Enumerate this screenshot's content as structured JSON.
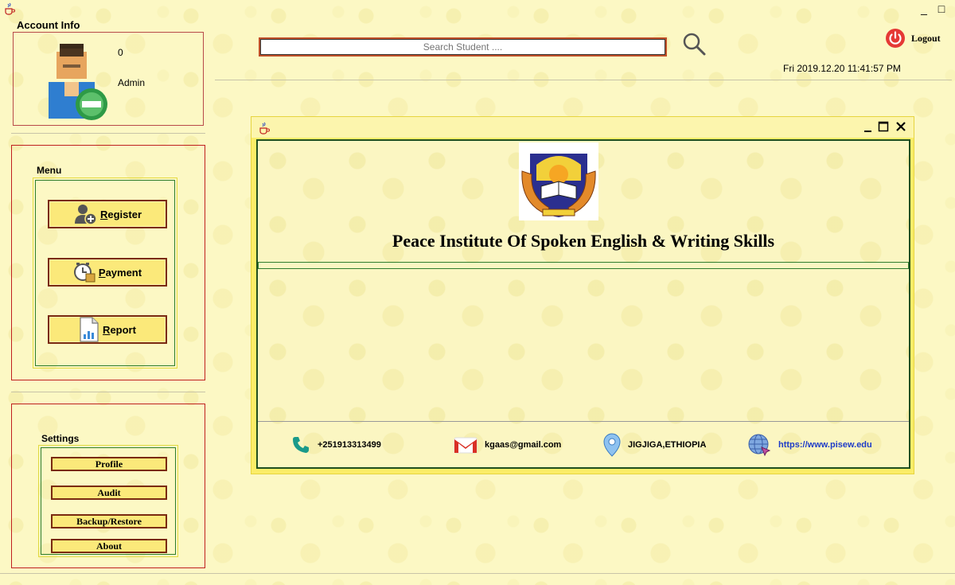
{
  "window": {
    "minimize_glyph": "_",
    "maximize_glyph": "□",
    "icon": "java-cup-icon"
  },
  "account": {
    "title": "Account Info",
    "user_id": "0",
    "role": "Admin",
    "avatar_icon": "user-avatar-icon"
  },
  "menu": {
    "title": "Menu",
    "buttons": [
      {
        "label": "Register",
        "icon": "add-user-icon"
      },
      {
        "label": "Payment",
        "icon": "clock-money-icon"
      },
      {
        "label": "Report",
        "icon": "report-document-icon"
      }
    ]
  },
  "settings": {
    "title": "Settings",
    "buttons": [
      {
        "label": "Profile"
      },
      {
        "label": "Audit"
      },
      {
        "label": "Backup/Restore"
      },
      {
        "label": "About"
      }
    ]
  },
  "header": {
    "search_placeholder": "Search Student ....",
    "logout_label": "Logout",
    "datetime": "Fri 2019.12.20 11:41:57 PM"
  },
  "internal_frame": {
    "institute_name": "Peace Institute Of Spoken English & Writing Skills",
    "contacts": {
      "phone": "+251913313499",
      "email": "kgaas@gmail.com",
      "location": "JIGJIGA,ETHIOPIA",
      "website": "https://www.pisew.edu"
    }
  },
  "colors": {
    "background": "#fcf8c4",
    "button_fill": "#fbe97a",
    "button_border": "#7a2a10",
    "panel_border": "#c02020",
    "frame_yellow": "#fbed68",
    "link_blue": "#1e3cc8",
    "logout_red": "#e53935"
  }
}
